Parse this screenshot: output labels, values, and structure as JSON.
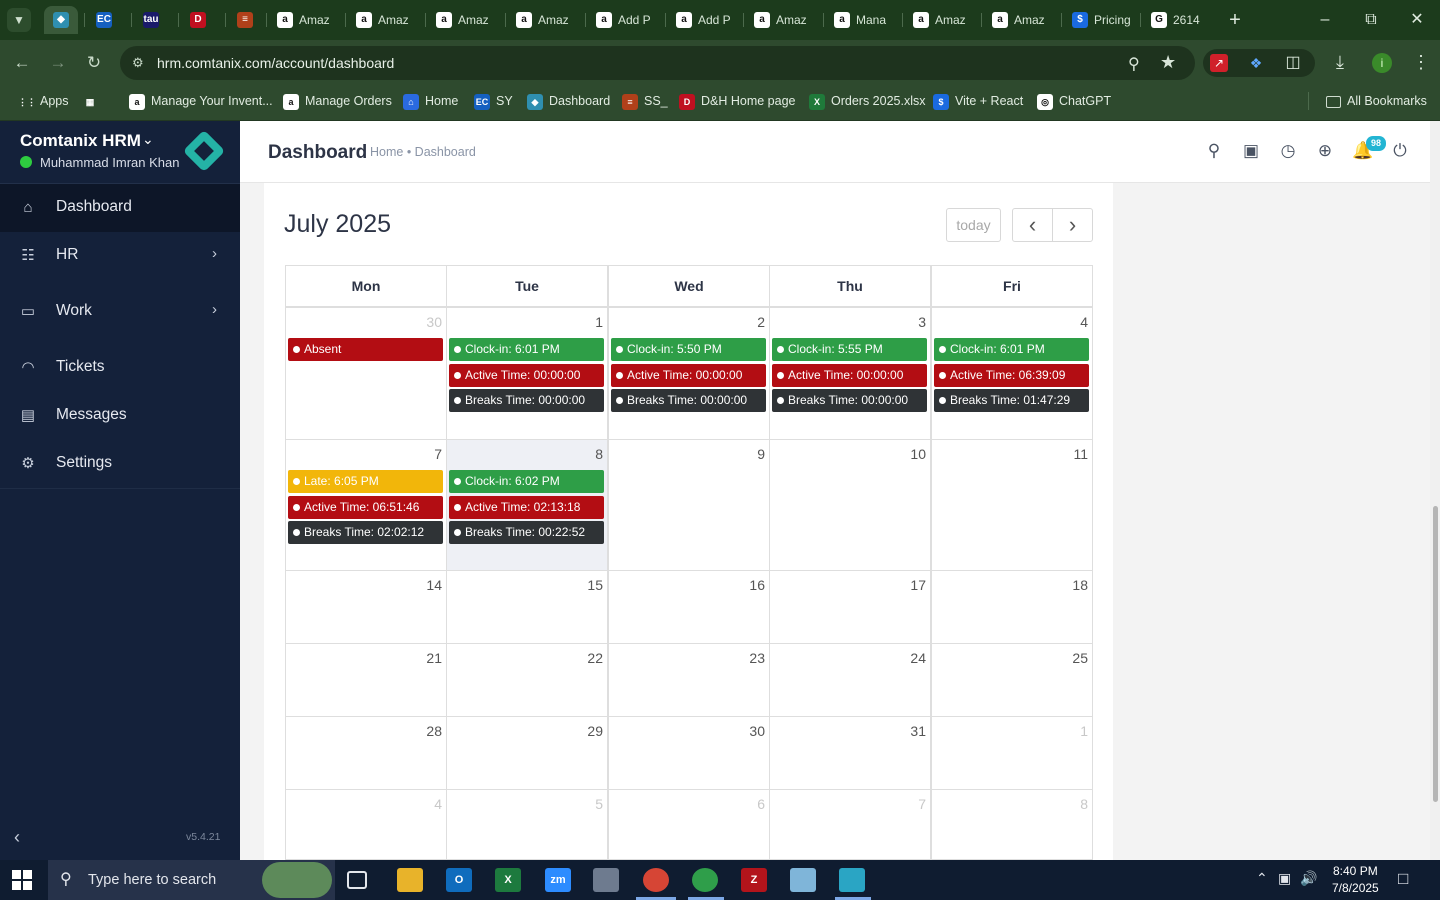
{
  "browser": {
    "tabs": [
      {
        "label": "",
        "icon": "comtanix-logo"
      },
      {
        "label": "",
        "icon": "ec-logo"
      },
      {
        "label": "",
        "icon": "tau-logo"
      },
      {
        "label": "",
        "icon": "dh-logo"
      },
      {
        "label": "",
        "icon": "stack-logo"
      },
      {
        "label": "Amaz",
        "icon": "amazon-logo"
      },
      {
        "label": "Amaz",
        "icon": "amazon-logo"
      },
      {
        "label": "Amaz",
        "icon": "amazon-logo"
      },
      {
        "label": "Amaz",
        "icon": "amazon-logo"
      },
      {
        "label": "Add P",
        "icon": "amazon-logo"
      },
      {
        "label": "Add P",
        "icon": "amazon-logo"
      },
      {
        "label": "Amaz",
        "icon": "amazon-logo"
      },
      {
        "label": "Mana",
        "icon": "amazon-logo"
      },
      {
        "label": "Amaz",
        "icon": "amazon-logo"
      },
      {
        "label": "Amaz",
        "icon": "amazon-logo"
      },
      {
        "label": "Pricing",
        "icon": "dollar-logo"
      },
      {
        "label": "2614",
        "icon": "google-logo"
      }
    ],
    "url": "hrm.comtanix.com/account/dashboard",
    "bookmarks": [
      {
        "label": "Apps",
        "icon": "apps-grid"
      },
      {
        "label": "",
        "icon": "tab-groups"
      },
      {
        "label": "Manage Your Invent...",
        "icon": "amazon-logo"
      },
      {
        "label": "Manage Orders",
        "icon": "amazon-logo"
      },
      {
        "label": "Home",
        "icon": "home-logo"
      },
      {
        "label": "SY",
        "icon": "ec-logo"
      },
      {
        "label": "Dashboard",
        "icon": "comtanix-logo"
      },
      {
        "label": "SS_",
        "icon": "stack-logo"
      },
      {
        "label": "D&H Home page",
        "icon": "dh-logo"
      },
      {
        "label": "Orders 2025.xlsx",
        "icon": "excel-logo"
      },
      {
        "label": "Vite + React",
        "icon": "dollar-logo"
      },
      {
        "label": "ChatGPT",
        "icon": "chatgpt-logo"
      }
    ],
    "all_bookmarks": "All Bookmarks",
    "profile_initial": "i"
  },
  "sidebar": {
    "brand": "Comtanix HRM",
    "user": "Muhammad Imran Khan",
    "items": [
      {
        "label": "Dashboard",
        "icon": "home-icon"
      },
      {
        "label": "HR",
        "icon": "users-icon"
      },
      {
        "label": "Work",
        "icon": "briefcase-icon"
      },
      {
        "label": "Tickets",
        "icon": "headset-icon"
      },
      {
        "label": "Messages",
        "icon": "message-icon"
      },
      {
        "label": "Settings",
        "icon": "gear-icon"
      }
    ],
    "version": "v5.4.21"
  },
  "header": {
    "title": "Dashboard",
    "breadcrumb": "Home • Dashboard",
    "notification_count": "98"
  },
  "calendar": {
    "title": "July 2025",
    "today_label": "today",
    "prev": "‹",
    "next": "›",
    "weekdays": [
      "Mon",
      "Tue",
      "Wed",
      "Thu",
      "Fri"
    ],
    "weeks": [
      {
        "days": [
          {
            "num": "30",
            "other": true,
            "events": [
              {
                "text": "Absent",
                "color": "red"
              }
            ]
          },
          {
            "num": "1",
            "events": [
              {
                "text": "Clock-in: 6:01 PM",
                "color": "green"
              },
              {
                "text": "Active Time: 00:00:00",
                "color": "red"
              },
              {
                "text": "Breaks Time: 00:00:00",
                "color": "dark"
              }
            ]
          },
          {
            "num": "2",
            "events": [
              {
                "text": "Clock-in: 5:50 PM",
                "color": "green"
              },
              {
                "text": "Active Time: 00:00:00",
                "color": "red"
              },
              {
                "text": "Breaks Time: 00:00:00",
                "color": "dark"
              }
            ]
          },
          {
            "num": "3",
            "events": [
              {
                "text": "Clock-in: 5:55 PM",
                "color": "green"
              },
              {
                "text": "Active Time: 00:00:00",
                "color": "red"
              },
              {
                "text": "Breaks Time: 00:00:00",
                "color": "dark"
              }
            ]
          },
          {
            "num": "4",
            "events": [
              {
                "text": "Clock-in: 6:01 PM",
                "color": "green"
              },
              {
                "text": "Active Time: 06:39:09",
                "color": "red"
              },
              {
                "text": "Breaks Time: 01:47:29",
                "color": "dark"
              }
            ]
          }
        ]
      },
      {
        "days": [
          {
            "num": "7",
            "events": [
              {
                "text": "Late: 6:05 PM",
                "color": "yellow"
              },
              {
                "text": "Active Time: 06:51:46",
                "color": "red"
              },
              {
                "text": "Breaks Time: 02:02:12",
                "color": "dark"
              }
            ]
          },
          {
            "num": "8",
            "today": true,
            "events": [
              {
                "text": "Clock-in: 6:02 PM",
                "color": "green"
              },
              {
                "text": "Active Time: 02:13:18",
                "color": "red"
              },
              {
                "text": "Breaks Time: 00:22:52",
                "color": "dark"
              }
            ]
          },
          {
            "num": "9",
            "events": []
          },
          {
            "num": "10",
            "events": []
          },
          {
            "num": "11",
            "events": []
          }
        ]
      },
      {
        "days": [
          {
            "num": "14",
            "events": []
          },
          {
            "num": "15",
            "events": []
          },
          {
            "num": "16",
            "events": []
          },
          {
            "num": "17",
            "events": []
          },
          {
            "num": "18",
            "events": []
          }
        ]
      },
      {
        "days": [
          {
            "num": "21",
            "events": []
          },
          {
            "num": "22",
            "events": []
          },
          {
            "num": "23",
            "events": []
          },
          {
            "num": "24",
            "events": []
          },
          {
            "num": "25",
            "events": []
          }
        ]
      },
      {
        "days": [
          {
            "num": "28",
            "events": []
          },
          {
            "num": "29",
            "events": []
          },
          {
            "num": "30",
            "events": []
          },
          {
            "num": "31",
            "events": []
          },
          {
            "num": "1",
            "other": true,
            "events": []
          }
        ]
      },
      {
        "days": [
          {
            "num": "4",
            "other": true,
            "events": []
          },
          {
            "num": "5",
            "other": true,
            "events": []
          },
          {
            "num": "6",
            "other": true,
            "events": []
          },
          {
            "num": "7",
            "other": true,
            "events": []
          },
          {
            "num": "8",
            "other": true,
            "events": []
          }
        ]
      }
    ]
  },
  "taskbar": {
    "search_placeholder": "Type here to search",
    "time": "8:40 PM",
    "date": "7/8/2025",
    "apps": [
      {
        "name": "task-view",
        "label": ""
      },
      {
        "name": "file-explorer",
        "label": ""
      },
      {
        "name": "outlook",
        "label": "O"
      },
      {
        "name": "excel",
        "label": "X"
      },
      {
        "name": "zoom",
        "label": "zm"
      },
      {
        "name": "calculator",
        "label": ""
      },
      {
        "name": "chrome",
        "label": ""
      },
      {
        "name": "chrome-profile",
        "label": ""
      },
      {
        "name": "filezilla",
        "label": "Z"
      },
      {
        "name": "notepad",
        "label": ""
      },
      {
        "name": "comtanix",
        "label": ""
      }
    ]
  },
  "colors": {
    "sidebar": "#14213a",
    "green": "#2e9e47",
    "red": "#b30d13",
    "dark": "#2f3336",
    "yellow": "#f2b60a",
    "accent": "#24b3a6"
  }
}
